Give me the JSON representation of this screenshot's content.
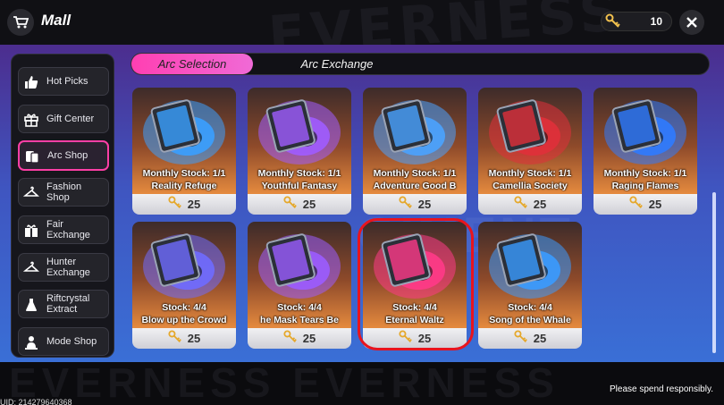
{
  "header": {
    "title": "Mall",
    "currency_value": "10"
  },
  "tabs": {
    "active": "Arc Selection",
    "inactive": "Arc Exchange"
  },
  "sidebar": {
    "items": [
      {
        "label": "Hot Picks",
        "icon": "thumbs-up-icon"
      },
      {
        "label": "Gift Center",
        "icon": "gift-icon"
      },
      {
        "label": "Arc Shop",
        "icon": "cards-icon",
        "active": true
      },
      {
        "label": "Fashion Shop",
        "icon": "hanger-icon"
      },
      {
        "label": "Fair Exchange",
        "icon": "gift-box-icon"
      },
      {
        "label": "Hunter Exchange",
        "icon": "hanger-icon"
      },
      {
        "label": "Riftcrystal Extract",
        "icon": "flask-icon"
      },
      {
        "label": "Mode Shop",
        "icon": "trophy-icon"
      }
    ]
  },
  "items": [
    {
      "stock": "Monthly Stock: 1/1",
      "name": "Reality Refuge",
      "price": "25",
      "color": "#3aa0ff"
    },
    {
      "stock": "Monthly Stock: 1/1",
      "name": "Youthful Fantasy",
      "price": "25",
      "color": "#a05cff"
    },
    {
      "stock": "Monthly Stock: 1/1",
      "name": "Adventure      Good B",
      "price": "25",
      "color": "#4aa3ff"
    },
    {
      "stock": "Monthly Stock: 1/1",
      "name": "Camellia Society",
      "price": "25",
      "color": "#e0303a"
    },
    {
      "stock": "Monthly Stock: 1/1",
      "name": "Raging Flames",
      "price": "25",
      "color": "#2f7bff"
    },
    {
      "stock": "Stock: 4/4",
      "name": "Blow up the Crowd",
      "price": "25",
      "color": "#6f6cff"
    },
    {
      "stock": "Stock: 4/4",
      "name": "he Mask      Tears Be",
      "price": "25",
      "color": "#9b5cff"
    },
    {
      "stock": "Stock: 4/4",
      "name": "Eternal Waltz",
      "price": "25",
      "color": "#ff3a88",
      "selected": true
    },
    {
      "stock": "Stock: 4/4",
      "name": "Song of the Whale",
      "price": "25",
      "color": "#3a9bff"
    }
  ],
  "footer": {
    "notice": "Please spend responsibly.",
    "uid": "UID: 214279640368"
  },
  "colors": {
    "accent": "#ff3fa6",
    "selection": "#e8141e"
  }
}
